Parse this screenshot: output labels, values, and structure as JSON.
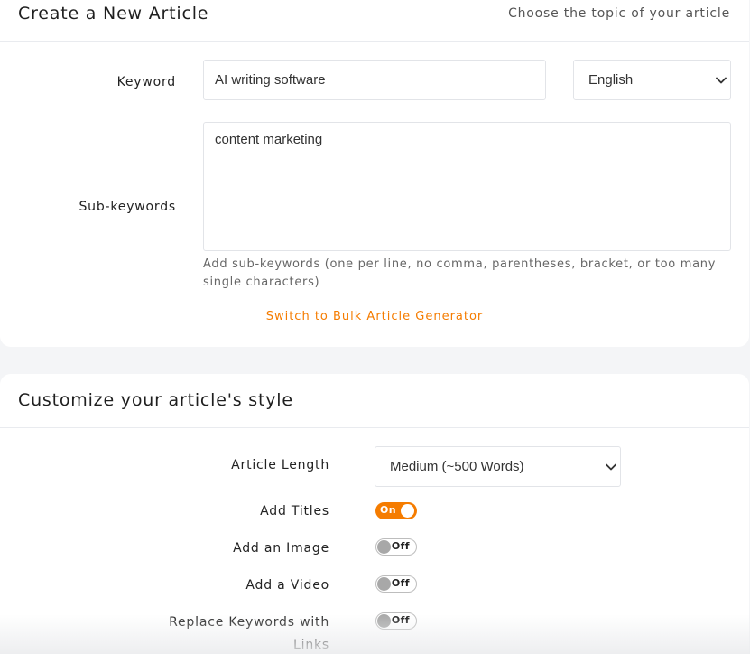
{
  "topic_card": {
    "title": "Create a New Article",
    "subtitle": "Choose the topic of your article",
    "keyword_label": "Keyword",
    "keyword_value": "AI writing software",
    "language_value": "English",
    "subkeywords_label": "Sub-keywords",
    "subkeywords_value": "content marketing",
    "subkeywords_help": "Add sub-keywords (one per line, no comma, parentheses, bracket, or too many single characters)",
    "bulk_link": "Switch to Bulk Article Generator"
  },
  "style_card": {
    "title": "Customize your article's style",
    "length_label": "Article Length",
    "length_value": "Medium (~500 Words)",
    "options": [
      {
        "label": "Add Titles",
        "state": "On",
        "enabled": true
      },
      {
        "label": "Add an Image",
        "state": "Off",
        "enabled": false
      },
      {
        "label": "Add a Video",
        "state": "Off",
        "enabled": false
      },
      {
        "label": "Replace Keywords with Links",
        "state": "Off",
        "enabled": false
      }
    ]
  },
  "colors": {
    "accent": "#f57c00",
    "toggle_off_knob": "#a8a8a8"
  },
  "icons": {
    "select_arrow": "chevron-down-icon"
  }
}
